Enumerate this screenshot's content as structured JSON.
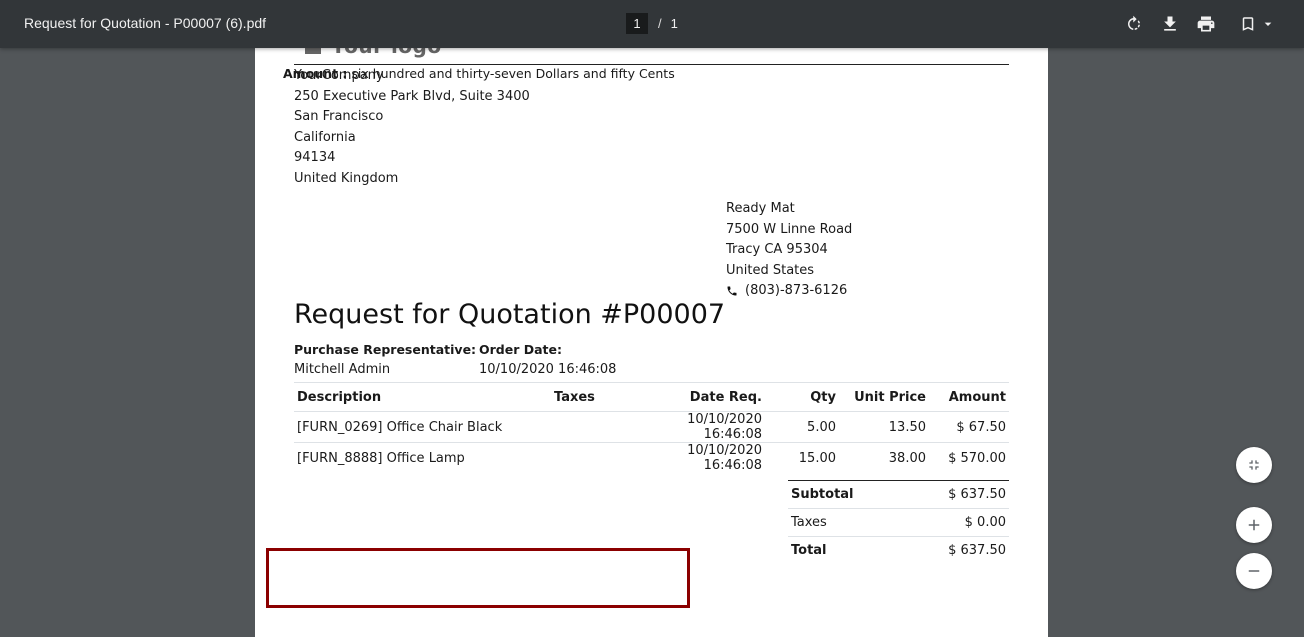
{
  "toolbar": {
    "title": "Request for Quotation - P00007 (6).pdf",
    "current_page": "1",
    "separator": "/",
    "total_pages": "1",
    "icons": [
      "rotate-icon",
      "download-icon",
      "print-icon",
      "bookmark-icon",
      "dropdown-arrow-icon"
    ]
  },
  "document": {
    "logo_text": "Your logo",
    "company": {
      "name": "YourCompany",
      "street": "250 Executive Park Blvd, Suite 3400",
      "city": "San Francisco",
      "state": "California",
      "zip": "94134",
      "country": "United Kingdom"
    },
    "vendor": {
      "name": "Ready Mat",
      "street": "7500 W Linne Road",
      "city_line": "Tracy CA 95304",
      "country": "United States",
      "phone": "(803)-873-6126"
    },
    "title": "Request for Quotation #P00007",
    "purchase_rep_label": "Purchase Representative:",
    "purchase_rep_value": "Mitchell Admin",
    "order_date_label": "Order Date:",
    "order_date_value": "10/10/2020 16:46:08",
    "table": {
      "headers": {
        "description": "Description",
        "taxes": "Taxes",
        "date_req": "Date Req.",
        "qty": "Qty",
        "unit_price": "Unit Price",
        "amount": "Amount"
      },
      "rows": [
        {
          "description": "[FURN_0269] Office Chair Black",
          "taxes": "",
          "date_req": "10/10/2020 16:46:08",
          "qty": "5.00",
          "unit_price": "13.50",
          "amount": "$ 67.50"
        },
        {
          "description": "[FURN_8888] Office Lamp",
          "taxes": "",
          "date_req": "10/10/2020 16:46:08",
          "qty": "15.00",
          "unit_price": "38.00",
          "amount": "$ 570.00"
        }
      ]
    },
    "totals": {
      "subtotal_label": "Subtotal",
      "subtotal_value": "$ 637.50",
      "taxes_label": "Taxes",
      "taxes_value": "$ 0.00",
      "total_label": "Total",
      "total_value": "$ 637.50"
    },
    "amount_words_label": "Amount :",
    "amount_words_value": "six hundred and thirty-seven Dollars and fifty Cents"
  },
  "zoom_controls": {
    "icons": [
      "fit-to-page-icon",
      "zoom-in-icon",
      "zoom-out-icon"
    ]
  },
  "colors": {
    "toolbar_bg": "#323639",
    "viewer_bg": "#525659",
    "highlight_border": "#8b0000"
  }
}
